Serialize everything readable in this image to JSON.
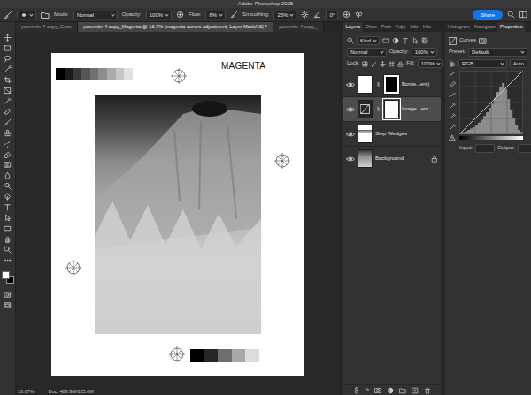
{
  "window": {
    "title": "Adobe Photoshop 2025"
  },
  "options_bar": {
    "mode_label": "Mode:",
    "mode": "Normal",
    "opacity_label": "Opacity:",
    "opacity": "100%",
    "flow_label": "Flow:",
    "flow": "8%",
    "smoothing_label": "Smoothing:",
    "smoothing": "25%",
    "angle": "0°",
    "share": "Share"
  },
  "doc_tabs": [
    {
      "label": "yosemite-4 copy_Cyan",
      "selected": false
    },
    {
      "label": "yosemite-4 copy_Magenta @ 16.7% (magenta curves adjustment, Layer Mask/16) *",
      "selected": true
    },
    {
      "label": "yosemite-4 copy_",
      "selected": false
    }
  ],
  "document": {
    "label": "MAGENTA",
    "wedge_top": [
      {
        "color": "#000000"
      },
      {
        "color": "#1c1c1c"
      },
      {
        "color": "#383838"
      },
      {
        "color": "#555555"
      },
      {
        "color": "#717171"
      },
      {
        "color": "#8d8d8d"
      },
      {
        "color": "#aaaaaa"
      },
      {
        "color": "#c6c6c6"
      },
      {
        "color": "#e2e2e2"
      }
    ],
    "wedge_bottom": [
      {
        "color": "#000000"
      },
      {
        "color": "#262626"
      },
      {
        "color": "#6e6e6e"
      },
      {
        "color": "#a8a8a8"
      },
      {
        "color": "#dcdcdc"
      }
    ]
  },
  "status_bar": {
    "zoom": "16.67%",
    "doc": "Doc: 489.9M/625.0M"
  },
  "layers_panel": {
    "tabs": [
      {
        "label": "Layers",
        "selected": true
      },
      {
        "label": "Chan",
        "selected": false
      },
      {
        "label": "Path",
        "selected": false
      },
      {
        "label": "Adju",
        "selected": false
      },
      {
        "label": "Libr",
        "selected": false
      },
      {
        "label": "Info",
        "selected": false
      }
    ],
    "filter": "Kind",
    "blend": "Normal",
    "opacity_label": "Opacity:",
    "opacity": "100%",
    "lock_label": "Lock:",
    "fill_label": "Fill:",
    "fill": "100%",
    "layers": [
      {
        "name": "Borde...ers)",
        "visible": true,
        "selected": false,
        "kind": "mask"
      },
      {
        "name": "Image...ent",
        "visible": true,
        "selected": true,
        "kind": "curves"
      },
      {
        "name": "Step Wedges",
        "visible": true,
        "selected": false,
        "kind": "pixel"
      },
      {
        "name": "Background",
        "visible": true,
        "selected": false,
        "kind": "background"
      }
    ],
    "fx": "fx"
  },
  "properties": {
    "tabs": [
      {
        "label": "Histogram",
        "selected": false
      },
      {
        "label": "Navigator",
        "selected": false
      },
      {
        "label": "Properties",
        "selected": true
      }
    ],
    "title": "Curves",
    "preset_label": "Preset:",
    "preset": "Default",
    "channel": "RGB",
    "auto": "Auto",
    "input_label": "Input:",
    "output_label": "Output:",
    "histogram": [
      2,
      3,
      4,
      6,
      8,
      10,
      13,
      16,
      20,
      25,
      30,
      36,
      42,
      50,
      58,
      64,
      70,
      62,
      48,
      34,
      22,
      12,
      6,
      3
    ]
  }
}
